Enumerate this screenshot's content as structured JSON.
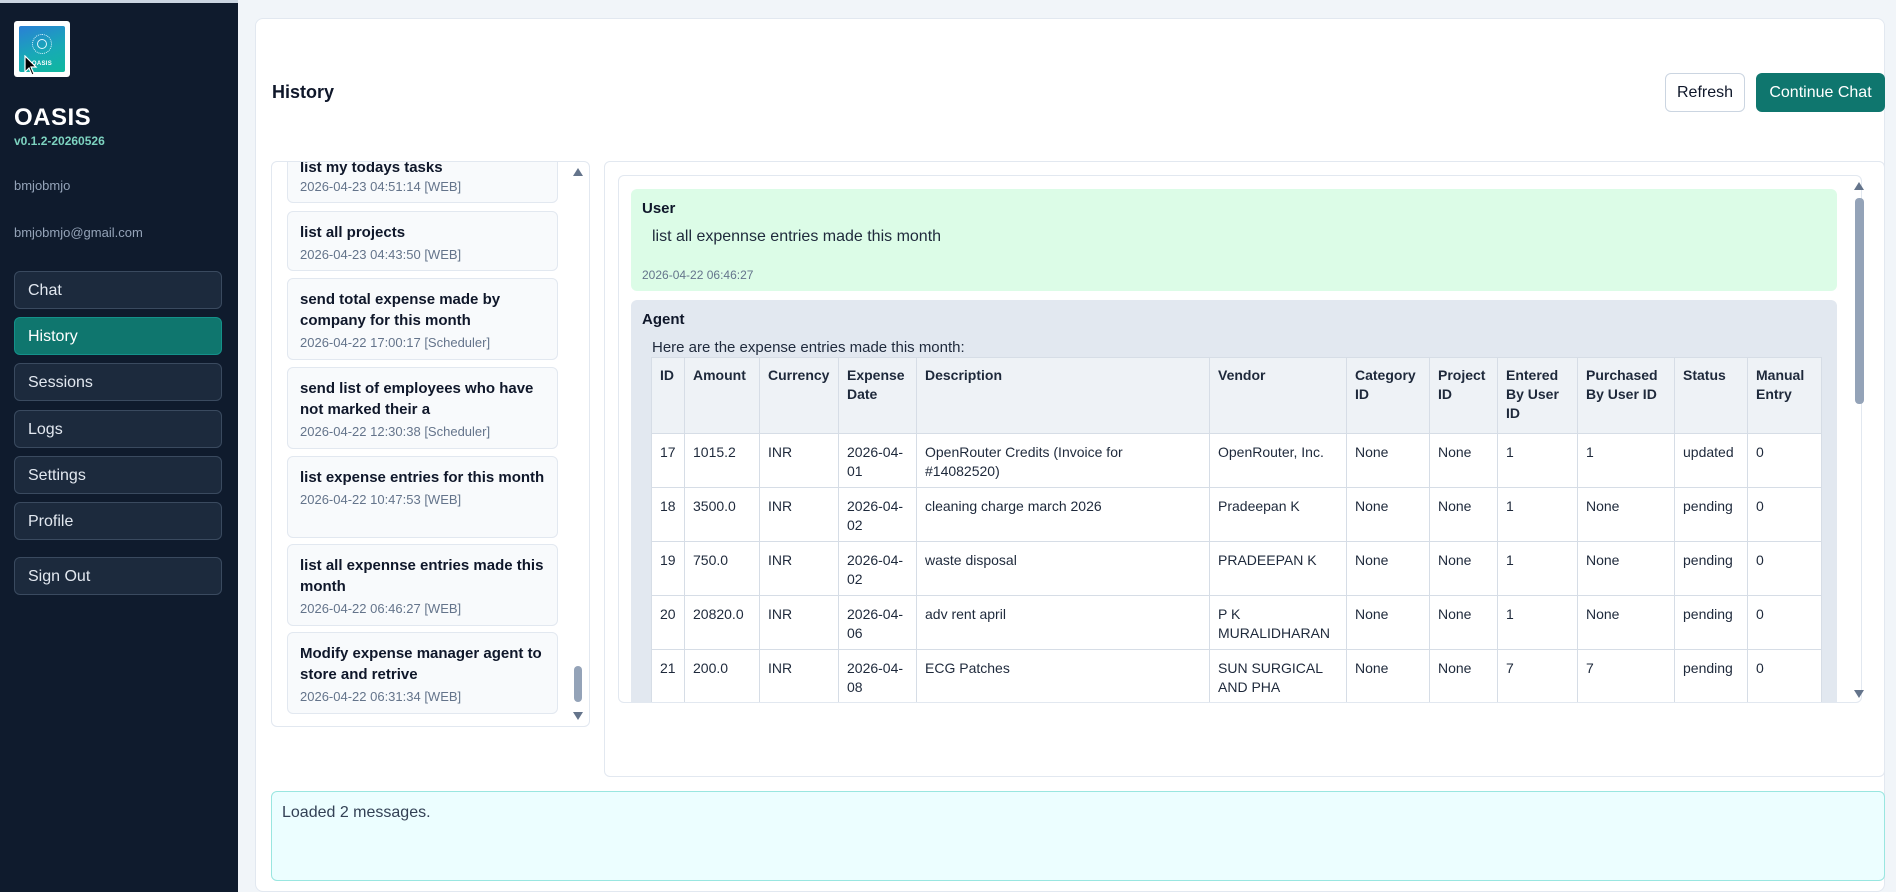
{
  "app": {
    "name": "OASIS",
    "version": "v0.1.2-20260526",
    "logo_text": "OASIS"
  },
  "user": {
    "name": "bmjobmjo",
    "email": "bmjobmjo@gmail.com"
  },
  "nav": {
    "items": [
      {
        "label": "Chat"
      },
      {
        "label": "History"
      },
      {
        "label": "Sessions"
      },
      {
        "label": "Logs"
      },
      {
        "label": "Settings"
      },
      {
        "label": "Profile"
      },
      {
        "label": "Sign Out"
      }
    ],
    "active": "History"
  },
  "header": {
    "title": "History",
    "refresh_label": "Refresh",
    "continue_label": "Continue Chat"
  },
  "sessions": [
    {
      "title": "list my todays tasks",
      "meta": "2026-04-23 04:51:14 [WEB]"
    },
    {
      "title": "list all projects",
      "meta": "2026-04-23 04:43:50 [WEB]"
    },
    {
      "title": "send total expense made by company for this month",
      "meta": "2026-04-22 17:00:17 [Scheduler]"
    },
    {
      "title": "send list of employees who have not marked their a",
      "meta": "2026-04-22 12:30:38 [Scheduler]"
    },
    {
      "title": "list expense entries for this month",
      "meta": "2026-04-22 10:47:53 [WEB]"
    },
    {
      "title": "list all expennse entries made this month",
      "meta": "2026-04-22 06:46:27 [WEB]"
    },
    {
      "title": "Modify expense manager agent to store and retrive",
      "meta": "2026-04-22 06:31:34 [WEB]"
    }
  ],
  "conversation": {
    "user": {
      "label": "User",
      "text": "list all expennse entries made this month",
      "time": "2026-04-22 06:46:27"
    },
    "agent": {
      "label": "Agent",
      "intro": "Here are the expense entries made this month:",
      "table": {
        "headers": [
          "ID",
          "Amount",
          "Currency",
          "Expense Date",
          "Description",
          "Vendor",
          "Category ID",
          "Project ID",
          "Entered By User ID",
          "Purchased By User ID",
          "Status",
          "Manual Entry"
        ],
        "rows": [
          [
            "17",
            "1015.2",
            "INR",
            "2026-04-01",
            "OpenRouter Credits (Invoice for #14082520)",
            "OpenRouter, Inc.",
            "None",
            "None",
            "1",
            "1",
            "updated",
            "0"
          ],
          [
            "18",
            "3500.0",
            "INR",
            "2026-04-02",
            "cleaning charge march 2026",
            "Pradeepan K",
            "None",
            "None",
            "1",
            "None",
            "pending",
            "0"
          ],
          [
            "19",
            "750.0",
            "INR",
            "2026-04-02",
            "waste disposal",
            "PRADEEPAN K",
            "None",
            "None",
            "1",
            "None",
            "pending",
            "0"
          ],
          [
            "20",
            "20820.0",
            "INR",
            "2026-04-06",
            "adv rent april",
            "P K MURALIDHARAN",
            "None",
            "None",
            "1",
            "None",
            "pending",
            "0"
          ],
          [
            "21",
            "200.0",
            "INR",
            "2026-04-08",
            "ECG Patches",
            "SUN SURGICAL AND PHA",
            "None",
            "None",
            "7",
            "7",
            "pending",
            "0"
          ]
        ]
      }
    }
  },
  "status": {
    "text": "Loaded 2 messages."
  },
  "colors": {
    "sidebar_bg": "#0f1b2d",
    "accent": "#0f766e",
    "user_msg_bg": "#dcfce7",
    "agent_msg_bg": "#e2e8f0",
    "status_bg": "#ecfeff"
  }
}
